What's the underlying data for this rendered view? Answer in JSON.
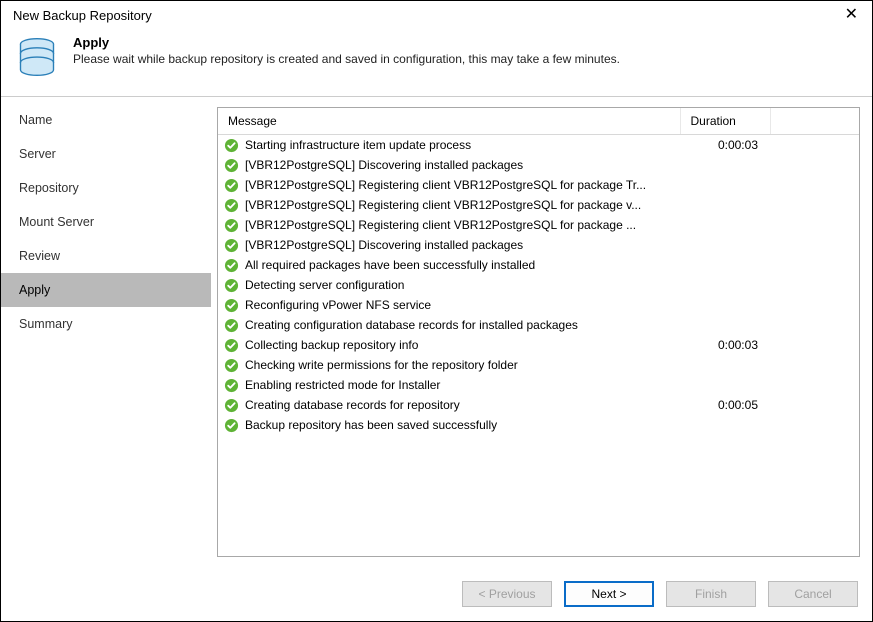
{
  "window": {
    "title": "New Backup Repository"
  },
  "header": {
    "title": "Apply",
    "subtitle": "Please wait while backup repository is created and saved in configuration, this may take a few minutes."
  },
  "sidebar": {
    "items": [
      {
        "label": "Name"
      },
      {
        "label": "Server"
      },
      {
        "label": "Repository"
      },
      {
        "label": "Mount Server"
      },
      {
        "label": "Review"
      },
      {
        "label": "Apply"
      },
      {
        "label": "Summary"
      }
    ],
    "activeIndex": 5
  },
  "table": {
    "headers": {
      "message": "Message",
      "duration": "Duration"
    },
    "rows": [
      {
        "message": "Starting infrastructure item update process",
        "duration": "0:00:03"
      },
      {
        "message": "[VBR12PostgreSQL] Discovering installed packages",
        "duration": ""
      },
      {
        "message": "[VBR12PostgreSQL] Registering client VBR12PostgreSQL for package Tr...",
        "duration": ""
      },
      {
        "message": "[VBR12PostgreSQL] Registering client VBR12PostgreSQL for package v...",
        "duration": ""
      },
      {
        "message": "[VBR12PostgreSQL] Registering client VBR12PostgreSQL for package ...",
        "duration": ""
      },
      {
        "message": "[VBR12PostgreSQL] Discovering installed packages",
        "duration": ""
      },
      {
        "message": "All required packages have been successfully installed",
        "duration": ""
      },
      {
        "message": "Detecting server configuration",
        "duration": ""
      },
      {
        "message": "Reconfiguring vPower NFS service",
        "duration": ""
      },
      {
        "message": "Creating configuration database records for installed packages",
        "duration": ""
      },
      {
        "message": "Collecting backup repository info",
        "duration": "0:00:03"
      },
      {
        "message": "Checking write permissions for the repository folder",
        "duration": ""
      },
      {
        "message": "Enabling restricted mode for Installer",
        "duration": ""
      },
      {
        "message": "Creating database records for repository",
        "duration": "0:00:05"
      },
      {
        "message": "Backup repository has been saved successfully",
        "duration": ""
      }
    ]
  },
  "buttons": {
    "previous": "< Previous",
    "next": "Next >",
    "finish": "Finish",
    "cancel": "Cancel"
  }
}
